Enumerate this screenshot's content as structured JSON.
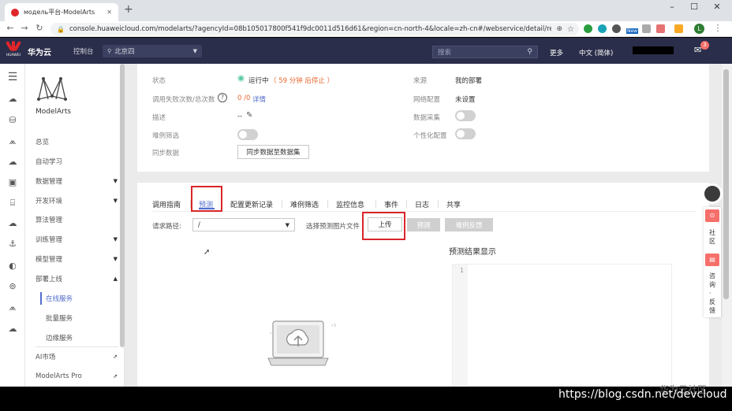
{
  "browser": {
    "tab_title": "модель平台-ModelArts",
    "url": "console.huaweicloud.com/modelarts/?agencyId=08b105017800f541f9dc0011d516d61&region=cn-north-4&locale=zh-cn#/webservice/detail/re...",
    "win_min": "–",
    "win_max": "☐",
    "win_close": "✕",
    "new_tab": "+",
    "avatar_letter": "L",
    "ext_new": "New"
  },
  "header": {
    "brand": "华为云",
    "logo_text": "HUAWEI",
    "console": "控制台",
    "region": "北京四",
    "search_placeholder": "搜索",
    "more": "更多",
    "lang": "中文 (简体)",
    "msg_count": "3"
  },
  "sidebar": {
    "app_name": "ModelArts",
    "items": [
      {
        "label": "总览"
      },
      {
        "label": "自动学习"
      },
      {
        "label": "数据管理"
      },
      {
        "label": "开发环境"
      },
      {
        "label": "算法管理"
      },
      {
        "label": "训练管理"
      },
      {
        "label": "模型管理"
      },
      {
        "label": "部署上线"
      }
    ],
    "subitems": [
      {
        "label": "在线服务"
      },
      {
        "label": "批量服务"
      },
      {
        "label": "边缘服务"
      }
    ],
    "ai_market": "AI市场",
    "pro": "ModelArts Pro"
  },
  "detail": {
    "status_label": "状态",
    "status_value": "运行中",
    "status_note": "（ 59 分钟 后停止 ）",
    "calls_label": "调用失败次数/总次数",
    "calls_value": "0 /0",
    "calls_link": "详情",
    "desc_label": "描述",
    "desc_value": "--",
    "hard_label": "难例筛选",
    "sync_label": "同步数据",
    "sync_button": "同步数据至数据集",
    "source_label": "来源",
    "source_value": "我的部署",
    "network_label": "网络配置",
    "network_value": "未设置",
    "collect_label": "数据采集",
    "personal_label": "个性化配置"
  },
  "tabs": [
    "调用指南",
    "预测",
    "配置更新记录",
    "难例筛选",
    "监控信息",
    "事件",
    "日志",
    "共享"
  ],
  "predict": {
    "path_label": "请求路径:",
    "path_value": "/",
    "choose_label": "选择预测图片文件",
    "upload_button": "上传",
    "predict_button": "预测",
    "hard_button": "难例反馈",
    "result_title": "预测结果显示",
    "line_number": "1"
  },
  "float": {
    "community": "社区",
    "consult": "咨询·反馈"
  },
  "watermark": {
    "url": "https://blog.csdn.net/devcloud",
    "faint": "华为云社区"
  }
}
